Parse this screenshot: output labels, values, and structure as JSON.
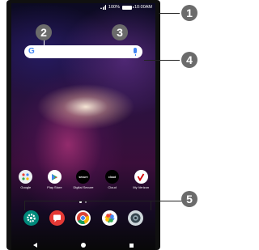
{
  "status_bar": {
    "battery_percent": "100%",
    "time": "10:00AM"
  },
  "dock_apps": [
    {
      "name": "settings-icon"
    },
    {
      "name": "messages-icon"
    },
    {
      "name": "chrome-icon"
    },
    {
      "name": "photos-icon"
    },
    {
      "name": "camera-icon"
    }
  ],
  "apps": [
    {
      "label": "Google",
      "icon_text": ""
    },
    {
      "label": "Play Store",
      "icon_text": ""
    },
    {
      "label": "Digital Secure",
      "icon_text": "secure"
    },
    {
      "label": "Cloud",
      "icon_text": "cloud"
    },
    {
      "label": "My Verizon",
      "icon_text": ""
    }
  ],
  "callouts": [
    "1",
    "2",
    "3",
    "4",
    "5"
  ],
  "colors": {
    "callout_bg": "#6b6b6b",
    "verizon_red": "#d50000",
    "google_blue": "#4285f4"
  }
}
